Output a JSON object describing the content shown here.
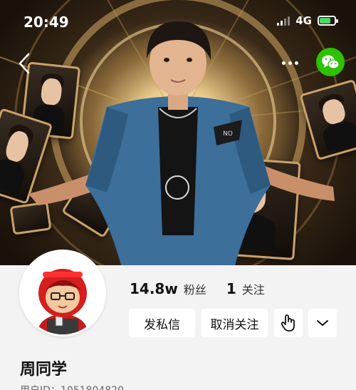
{
  "status_bar": {
    "time": "20:49",
    "network": "4G",
    "battery_level": 0.7,
    "battery_color": "#4cd964"
  },
  "header": {
    "back_icon": "chevron-left-icon",
    "more_icon": "more-dots-icon",
    "share_icon": "wechat-icon",
    "share_color": "#2dc100"
  },
  "profile": {
    "name": "周同学",
    "user_id_label": "用户ID：1051804820",
    "followers_count": "14.8w",
    "followers_label": "粉丝",
    "following_count": "1",
    "following_label": "关注"
  },
  "actions": {
    "message_label": "发私信",
    "unfollow_label": "取消关注",
    "gesture_icon": "hand-pointer-icon",
    "expand_icon": "chevron-down-icon"
  }
}
